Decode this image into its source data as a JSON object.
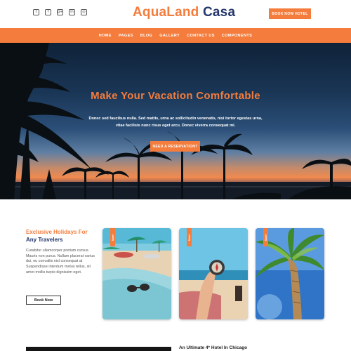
{
  "header": {
    "logo_part1": "AquaLand",
    "logo_part2": "Casa",
    "book_button": "BOOK NOW HOTEL",
    "social_icons": [
      {
        "name": "twitter-icon",
        "glyph": "t"
      },
      {
        "name": "facebook-icon",
        "glyph": "f"
      },
      {
        "name": "google-plus-icon",
        "glyph": "g+"
      },
      {
        "name": "linkedin-icon",
        "glyph": "in"
      },
      {
        "name": "instagram-icon",
        "glyph": "◎"
      }
    ]
  },
  "nav": {
    "items": [
      "HOME",
      "PAGES",
      "BLOG",
      "GALLERY",
      "CONTACT US",
      "COMPONENTS"
    ]
  },
  "hero": {
    "title": "Make Your Vacation Comfortable",
    "text": "Donec sed faucibus nulla. Sed mattis, urna ac sollicitudin venenatis, nisi tortor egestas urna, vitae facilisis nunc risus eget arcu. Donec viverra consequat mi.",
    "button": "NEED A RESERVATION?"
  },
  "holidays": {
    "title_line1": "Exclusive Holidays For",
    "title_line2": "Any Travelers",
    "text": "Curabitur ullamcorper pretium cursus. Mauris non purus. Nullam placerat varius dui, eu convallis nisl consequat at Suspendisse interdum metus tellus, sit amet mollis turpis dignissim eget.",
    "button": "Book Now"
  },
  "cards": [
    {
      "tag": "Sale!"
    },
    {
      "tag": "Sale!"
    },
    {
      "tag": "Sale!"
    }
  ],
  "bottom": {
    "heading": "An Ultimate 4* Hotel In Chicago"
  },
  "colors": {
    "accent": "#f47c3c",
    "navy": "#24366b"
  }
}
